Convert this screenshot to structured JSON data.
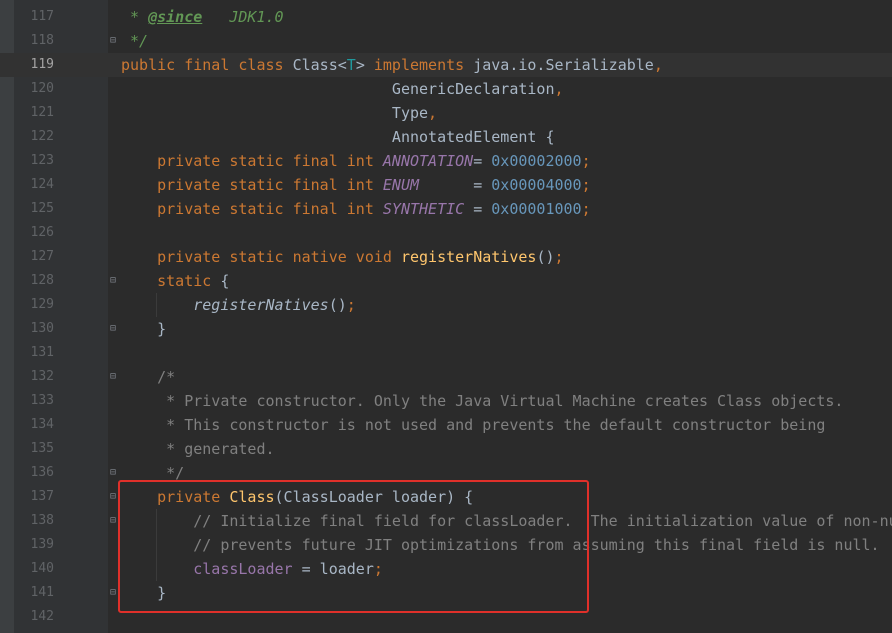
{
  "editor": {
    "lines": [
      {
        "num": "117",
        "tokens": [
          {
            "t": " * ",
            "c": "doc"
          },
          {
            "t": "@since",
            "c": "doctag"
          },
          {
            "t": "   JDK1.0",
            "c": "doc"
          }
        ]
      },
      {
        "num": "118",
        "tokens": [
          {
            "t": " */",
            "c": "doc"
          }
        ]
      },
      {
        "num": "119",
        "current": true,
        "tokens": [
          {
            "t": "public final class ",
            "c": "kw"
          },
          {
            "t": "Class",
            "c": "plain"
          },
          {
            "t": "<",
            "c": "plain"
          },
          {
            "t": "T",
            "c": "typeparam"
          },
          {
            "t": "> ",
            "c": "plain"
          },
          {
            "t": "implements ",
            "c": "kw"
          },
          {
            "t": "java.io.Serializable",
            "c": "plain"
          },
          {
            "t": ",",
            "c": "kw"
          }
        ]
      },
      {
        "num": "120",
        "tokens": [
          {
            "t": "                              GenericDeclaration",
            "c": "plain"
          },
          {
            "t": ",",
            "c": "kw"
          }
        ]
      },
      {
        "num": "121",
        "tokens": [
          {
            "t": "                              Type",
            "c": "plain"
          },
          {
            "t": ",",
            "c": "kw"
          }
        ]
      },
      {
        "num": "122",
        "tokens": [
          {
            "t": "                              AnnotatedElement {",
            "c": "plain"
          }
        ]
      },
      {
        "num": "123",
        "tokens": [
          {
            "t": "    private static final int ",
            "c": "kw"
          },
          {
            "t": "ANNOTATION",
            "c": "field"
          },
          {
            "t": "= ",
            "c": "plain"
          },
          {
            "t": "0x00002000",
            "c": "num"
          },
          {
            "t": ";",
            "c": "kw"
          }
        ]
      },
      {
        "num": "124",
        "tokens": [
          {
            "t": "    private static final int ",
            "c": "kw"
          },
          {
            "t": "ENUM",
            "c": "field"
          },
          {
            "t": "      = ",
            "c": "plain"
          },
          {
            "t": "0x00004000",
            "c": "num"
          },
          {
            "t": ";",
            "c": "kw"
          }
        ]
      },
      {
        "num": "125",
        "tokens": [
          {
            "t": "    private static final int ",
            "c": "kw"
          },
          {
            "t": "SYNTHETIC",
            "c": "field"
          },
          {
            "t": " = ",
            "c": "plain"
          },
          {
            "t": "0x00001000",
            "c": "num"
          },
          {
            "t": ";",
            "c": "kw"
          }
        ]
      },
      {
        "num": "126",
        "tokens": []
      },
      {
        "num": "127",
        "tokens": [
          {
            "t": "    private static native void ",
            "c": "kw"
          },
          {
            "t": "registerNatives",
            "c": "fn"
          },
          {
            "t": "()",
            "c": "plain"
          },
          {
            "t": ";",
            "c": "kw"
          }
        ]
      },
      {
        "num": "128",
        "tokens": [
          {
            "t": "    static ",
            "c": "kw"
          },
          {
            "t": "{",
            "c": "plain"
          }
        ]
      },
      {
        "num": "129",
        "tokens": [
          {
            "t": "        ",
            "c": "plain"
          },
          {
            "t": "registerNatives",
            "c": "ital"
          },
          {
            "t": "()",
            "c": "plain"
          },
          {
            "t": ";",
            "c": "kw"
          }
        ]
      },
      {
        "num": "130",
        "tokens": [
          {
            "t": "    }",
            "c": "plain"
          }
        ]
      },
      {
        "num": "131",
        "tokens": []
      },
      {
        "num": "132",
        "tokens": [
          {
            "t": "    /*",
            "c": "cmt"
          }
        ]
      },
      {
        "num": "133",
        "tokens": [
          {
            "t": "     * Private constructor. Only the Java Virtual Machine creates Class objects.",
            "c": "cmt"
          }
        ]
      },
      {
        "num": "134",
        "tokens": [
          {
            "t": "     * This constructor is not used and prevents the default constructor being",
            "c": "cmt"
          }
        ]
      },
      {
        "num": "135",
        "tokens": [
          {
            "t": "     * generated.",
            "c": "cmt"
          }
        ]
      },
      {
        "num": "136",
        "tokens": [
          {
            "t": "     */",
            "c": "cmt"
          }
        ]
      },
      {
        "num": "137",
        "tokens": [
          {
            "t": "    private ",
            "c": "kw"
          },
          {
            "t": "Class",
            "c": "fn"
          },
          {
            "t": "(ClassLoader loader) {",
            "c": "plain"
          }
        ]
      },
      {
        "num": "138",
        "tokens": [
          {
            "t": "        // Initialize final field for classLoader.  The initialization value of non-nu",
            "c": "cmt"
          }
        ]
      },
      {
        "num": "139",
        "tokens": [
          {
            "t": "        // prevents future JIT optimizations from assuming this final field is null.",
            "c": "cmt"
          }
        ]
      },
      {
        "num": "140",
        "tokens": [
          {
            "t": "        ",
            "c": "plain"
          },
          {
            "t": "classLoader",
            "c": "ifield"
          },
          {
            "t": " = loader",
            "c": "plain"
          },
          {
            "t": ";",
            "c": "kw"
          }
        ]
      },
      {
        "num": "141",
        "tokens": [
          {
            "t": "    }",
            "c": "plain"
          }
        ]
      },
      {
        "num": "142",
        "tokens": []
      }
    ],
    "folds": [
      "118",
      "128",
      "130",
      "132",
      "136",
      "137",
      "138",
      "141"
    ]
  },
  "colors": {
    "background": "#2b2b2b",
    "keyword": "#cc7832",
    "function": "#ffc66d",
    "field": "#9876aa",
    "number": "#6897bb",
    "comment": "#808080",
    "doc_comment": "#629755",
    "highlight_box": "#e0302a"
  }
}
